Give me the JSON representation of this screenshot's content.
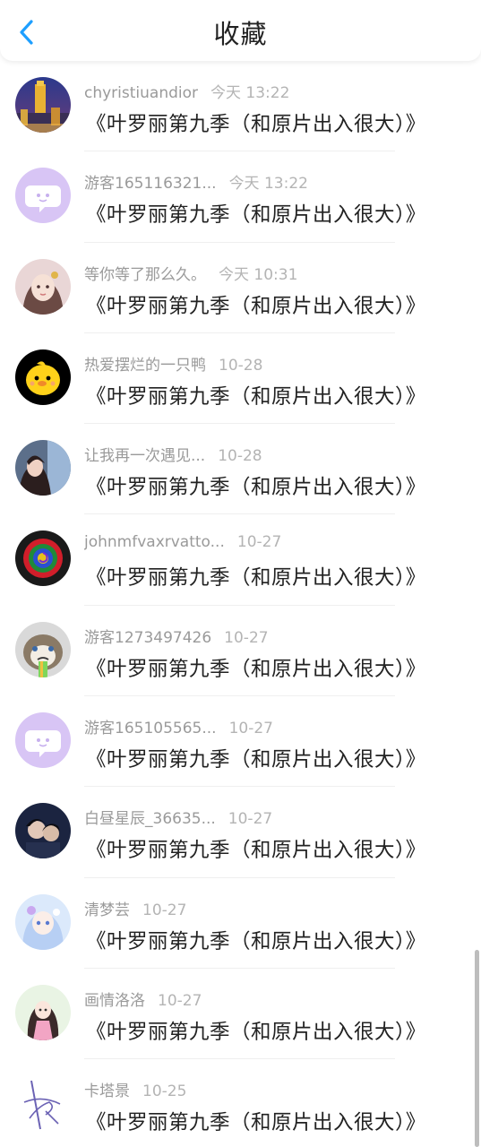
{
  "header": {
    "title": "收藏",
    "back_icon": "chevron-left-icon",
    "accent": "#1e9fff"
  },
  "items": [
    {
      "user": "chyristiuandior",
      "time": "今天 13:22",
      "text": "《叶罗丽第九季（和原片出入很大）》",
      "avatar": "city-tower"
    },
    {
      "user": "游客165116321...",
      "time": "今天 13:22",
      "text": "《叶罗丽第九季（和原片出入很大）》",
      "avatar": "chat-bubble"
    },
    {
      "user": "等你等了那么久。",
      "time": "今天 10:31",
      "text": "《叶罗丽第九季（和原片出入很大）》",
      "avatar": "girl-portrait"
    },
    {
      "user": "热爱摆烂的一只鸭",
      "time": "10-28",
      "text": "《叶罗丽第九季（和原片出入很大）》",
      "avatar": "yellow-duck"
    },
    {
      "user": "让我再一次遇见...",
      "time": "10-28",
      "text": "《叶罗丽第九季（和原片出入很大）》",
      "avatar": "girl-window"
    },
    {
      "user": "johnmfvaxrvatto...",
      "time": "10-27",
      "text": "《叶罗丽第九季（和原片出入很大）》",
      "avatar": "rainbow-rose"
    },
    {
      "user": "游客1273497426",
      "time": "10-27",
      "text": "《叶罗丽第九季（和原片出入很大）》",
      "avatar": "grumpy-cat"
    },
    {
      "user": "游客165105565...",
      "time": "10-27",
      "text": "《叶罗丽第九季（和原片出入很大）》",
      "avatar": "chat-bubble"
    },
    {
      "user": "白昼星辰_36635...",
      "time": "10-27",
      "text": "《叶罗丽第九季（和原片出入很大）》",
      "avatar": "dark-couple"
    },
    {
      "user": "清梦芸",
      "time": "10-27",
      "text": "《叶罗丽第九季（和原片出入很大）》",
      "avatar": "anime-doll"
    },
    {
      "user": "画情洛洛",
      "time": "10-27",
      "text": "《叶罗丽第九季（和原片出入很大）》",
      "avatar": "anime-girl-pink"
    },
    {
      "user": "卡塔景",
      "time": "10-25",
      "text": "《叶罗丽第九季（和原片出入很大）》",
      "avatar": "signature"
    }
  ]
}
